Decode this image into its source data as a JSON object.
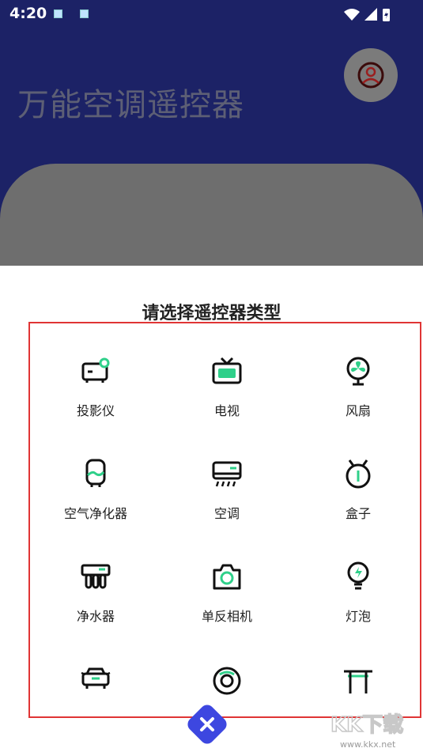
{
  "status_bar": {
    "time": "4:20"
  },
  "header": {
    "app_title": "万能空调遥控器",
    "profile_icon": "person-icon"
  },
  "sheet": {
    "title": "请选择遥控器类型",
    "items": [
      {
        "label": "投影仪",
        "icon": "projector-icon"
      },
      {
        "label": "电视",
        "icon": "tv-icon"
      },
      {
        "label": "风扇",
        "icon": "fan-icon"
      },
      {
        "label": "空气净化器",
        "icon": "air-purifier-icon"
      },
      {
        "label": "空调",
        "icon": "air-conditioner-icon"
      },
      {
        "label": "盒子",
        "icon": "tv-box-icon"
      },
      {
        "label": "净水器",
        "icon": "water-purifier-icon"
      },
      {
        "label": "单反相机",
        "icon": "camera-icon"
      },
      {
        "label": "灯泡",
        "icon": "bulb-icon"
      },
      {
        "label": "",
        "icon": "car-icon"
      },
      {
        "label": "",
        "icon": "robot-vacuum-icon"
      },
      {
        "label": "",
        "icon": "gate-icon"
      }
    ],
    "close_icon": "close-icon"
  },
  "watermark": {
    "text": "KK下载",
    "url": "www.kkx.net"
  },
  "colors": {
    "navy": "#1c2266",
    "accent": "#2fd08a",
    "border_red": "#e03535",
    "close_blue": "#3d47e0"
  }
}
